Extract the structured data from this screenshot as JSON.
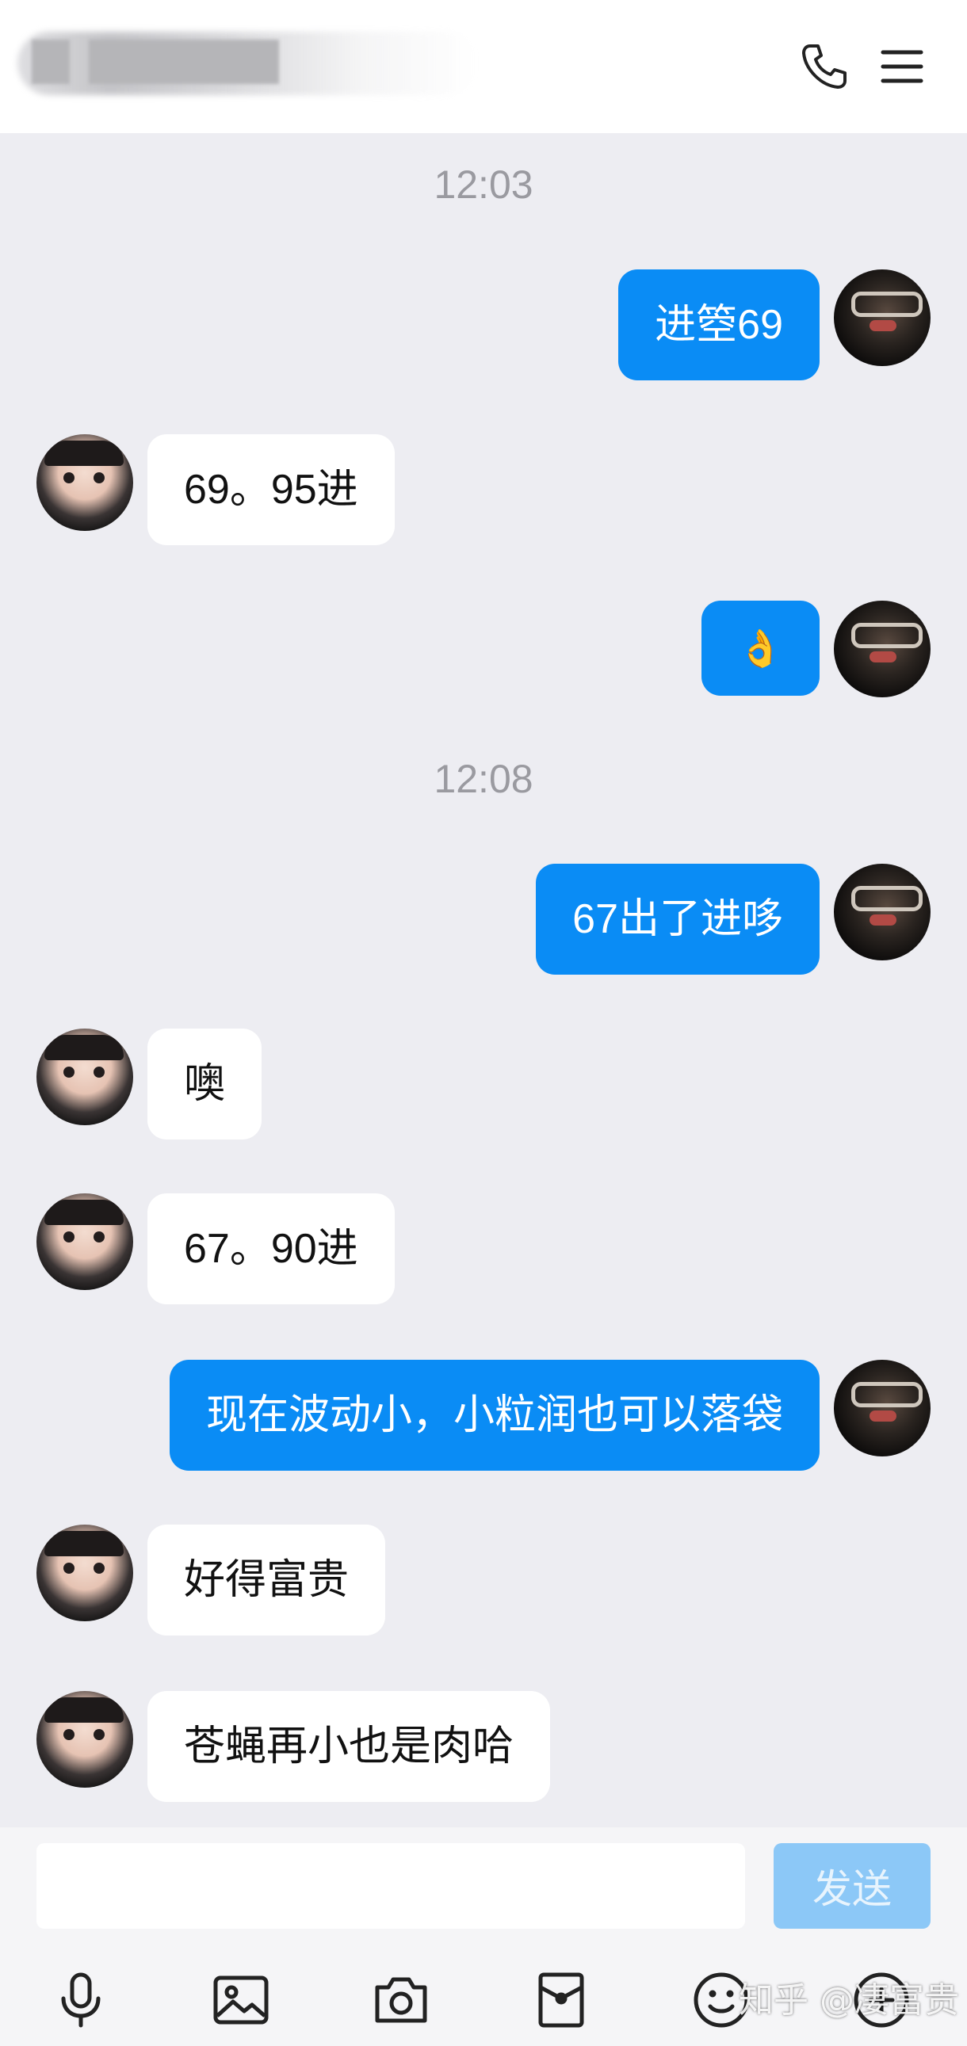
{
  "header": {
    "call_icon": "phone-icon",
    "menu_icon": "menu-icon"
  },
  "timestamps": [
    "12:03",
    "12:08"
  ],
  "messages": [
    {
      "side": "me",
      "text": "进箜69"
    },
    {
      "side": "other",
      "text": "69。95进"
    },
    {
      "side": "me",
      "text": "👌"
    },
    {
      "side": "me",
      "text": "67出了进哆"
    },
    {
      "side": "other",
      "text": "噢"
    },
    {
      "side": "other",
      "text": "67。90进"
    },
    {
      "side": "me",
      "text": "现在波动小，小粒润也可以落袋"
    },
    {
      "side": "other",
      "text": "好得富贵"
    },
    {
      "side": "other",
      "text": "苍蝇再小也是肉哈"
    }
  ],
  "input": {
    "placeholder": "",
    "send_label": "发送"
  },
  "toolbar": [
    "microphone-icon",
    "image-icon",
    "camera-icon",
    "red-packet-icon",
    "emoji-icon",
    "plus-icon"
  ],
  "watermark": "知乎 @凄富贵",
  "colors": {
    "my_bubble": "#0a8cf5",
    "other_bubble": "#ffffff",
    "send_button": "#8cc8f7",
    "background": "#ededf2"
  }
}
